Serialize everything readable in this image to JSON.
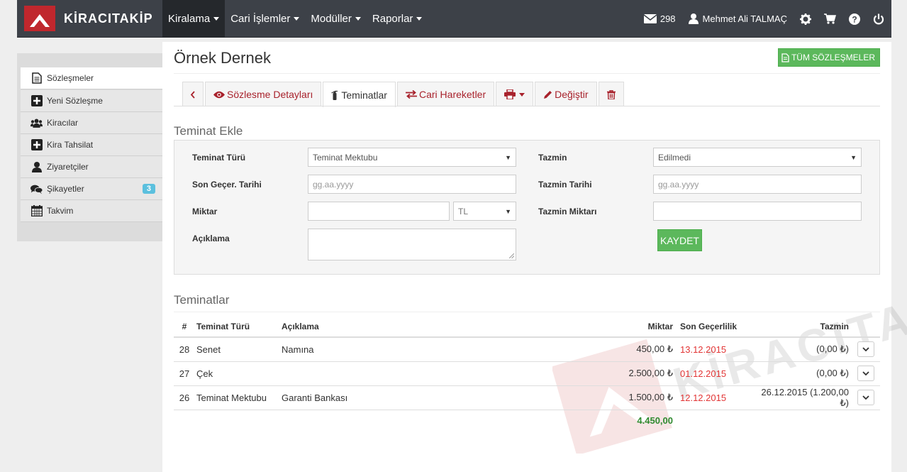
{
  "brand": {
    "name": "KİRACITAKİP"
  },
  "nav": {
    "menus": [
      "Kiralama",
      "Cari İşlemler",
      "Modüller",
      "Raporlar"
    ],
    "messages_count": "298",
    "user_name": "Mehmet Ali TALMAÇ"
  },
  "sidebar": {
    "items": [
      {
        "label": "Sözleşmeler",
        "icon": "document-icon"
      },
      {
        "label": "Yeni Sözleşme",
        "icon": "plus-square-icon"
      },
      {
        "label": "Kiracılar",
        "icon": "users-icon"
      },
      {
        "label": "Kira Tahsilat",
        "icon": "plus-square-icon"
      },
      {
        "label": "Ziyaretçiler",
        "icon": "user-icon"
      },
      {
        "label": "Şikayetler",
        "icon": "comments-icon",
        "badge": "3"
      },
      {
        "label": "Takvim",
        "icon": "calendar-icon"
      }
    ]
  },
  "page": {
    "title": "Örnek Dernek",
    "all_contracts_label": "TÜM SÖZLEŞMELER"
  },
  "tabs": {
    "details": "Sözlesme Detayları",
    "guarantees": "Teminatlar",
    "transactions": "Cari Hareketler",
    "edit": "Değiştir"
  },
  "form": {
    "section_title": "Teminat Ekle",
    "type_label": "Teminat Türü",
    "type_value": "Teminat Mektubu",
    "expiry_label": "Son Geçer. Tarihi",
    "expiry_placeholder": "gg.aa.yyyy",
    "amount_label": "Miktar",
    "amount_value": "",
    "currency_value": "TL",
    "description_label": "Açıklama",
    "description_value": "",
    "indemnity_label": "Tazmin",
    "indemnity_value": "Edilmedi",
    "indemnity_date_label": "Tazmin Tarihi",
    "indemnity_date_placeholder": "gg.aa.yyyy",
    "indemnity_amount_label": "Tazmin Miktarı",
    "indemnity_amount_value": "",
    "save_label": "KAYDET"
  },
  "table": {
    "section_title": "Teminatlar",
    "headers": {
      "no": "#",
      "type": "Teminat Türü",
      "description": "Açıklama",
      "amount": "Miktar",
      "expiry": "Son Geçerlilik",
      "indemnity": "Tazmin"
    },
    "rows": [
      {
        "no": "28",
        "type": "Senet",
        "description": "Namına",
        "amount": "450,00 ₺",
        "expiry": "13.12.2015",
        "indemnity": "(0,00 ₺)"
      },
      {
        "no": "27",
        "type": "Çek",
        "description": "",
        "amount": "2.500,00 ₺",
        "expiry": "01.12.2015",
        "indemnity": "(0,00 ₺)"
      },
      {
        "no": "26",
        "type": "Teminat Mektubu",
        "description": "Garanti Bankası",
        "amount": "1.500,00 ₺",
        "expiry": "12.12.2015",
        "indemnity": "26.12.2015 (1.200,00 ₺)"
      }
    ],
    "total": "4.450,00"
  },
  "colors": {
    "navbar": "#3d4148",
    "accent_red": "#c0272d",
    "link_red": "#a8222c",
    "success_green": "#5cb85c",
    "date_red": "#e23535",
    "badge_blue": "#5bc0de"
  }
}
